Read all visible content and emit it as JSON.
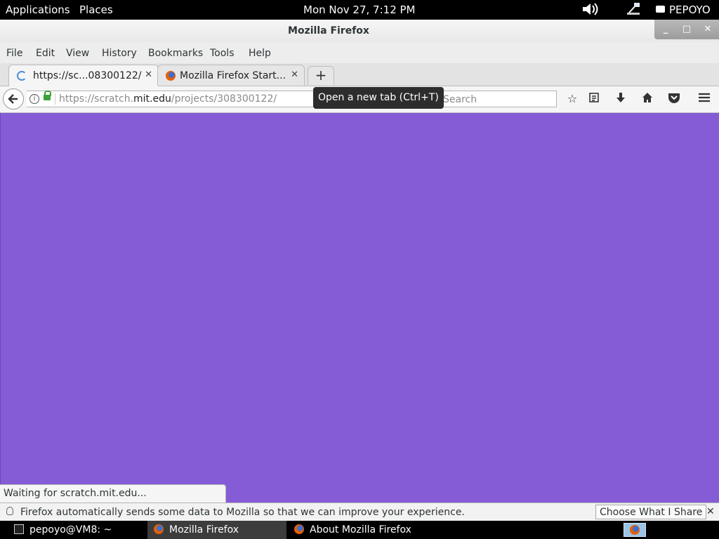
{
  "top_panel": {
    "applications": "Applications",
    "places": "Places",
    "clock": "Mon Nov 27,  7:12 PM",
    "user": "PEPOYO"
  },
  "window": {
    "title": "Mozilla Firefox",
    "minimize": "_",
    "maximize": "□",
    "close": "✕"
  },
  "menu": [
    "File",
    "Edit",
    "View",
    "History",
    "Bookmarks",
    "Tools",
    "Help"
  ],
  "tabs": [
    {
      "label": "https://sc...08300122/",
      "close": "✕",
      "loading": true
    },
    {
      "label": "Mozilla Firefox Start...",
      "close": "✕"
    }
  ],
  "new_tab_symbol": "+",
  "nav": {
    "url_prefix": "https://scratch.",
    "url_host": "mit.edu",
    "url_path": "/projects/308300122/",
    "tooltip": "Open a new tab (Ctrl+T)",
    "search_placeholder": "Search"
  },
  "content": {
    "background": "#855cd6"
  },
  "status_text": "Waiting for scratch.mit.edu...",
  "notification": {
    "message": "Firefox automatically sends some data to Mozilla so that we can improve your experience.",
    "button": "Choose What I Share",
    "close": "✕"
  },
  "taskbar": [
    {
      "label": "pepoyo@VM8: ~",
      "icon": "terminal-icon"
    },
    {
      "label": "Mozilla Firefox",
      "icon": "firefox-icon",
      "selected": true
    },
    {
      "label": "About Mozilla Firefox",
      "icon": "firefox-icon"
    }
  ]
}
